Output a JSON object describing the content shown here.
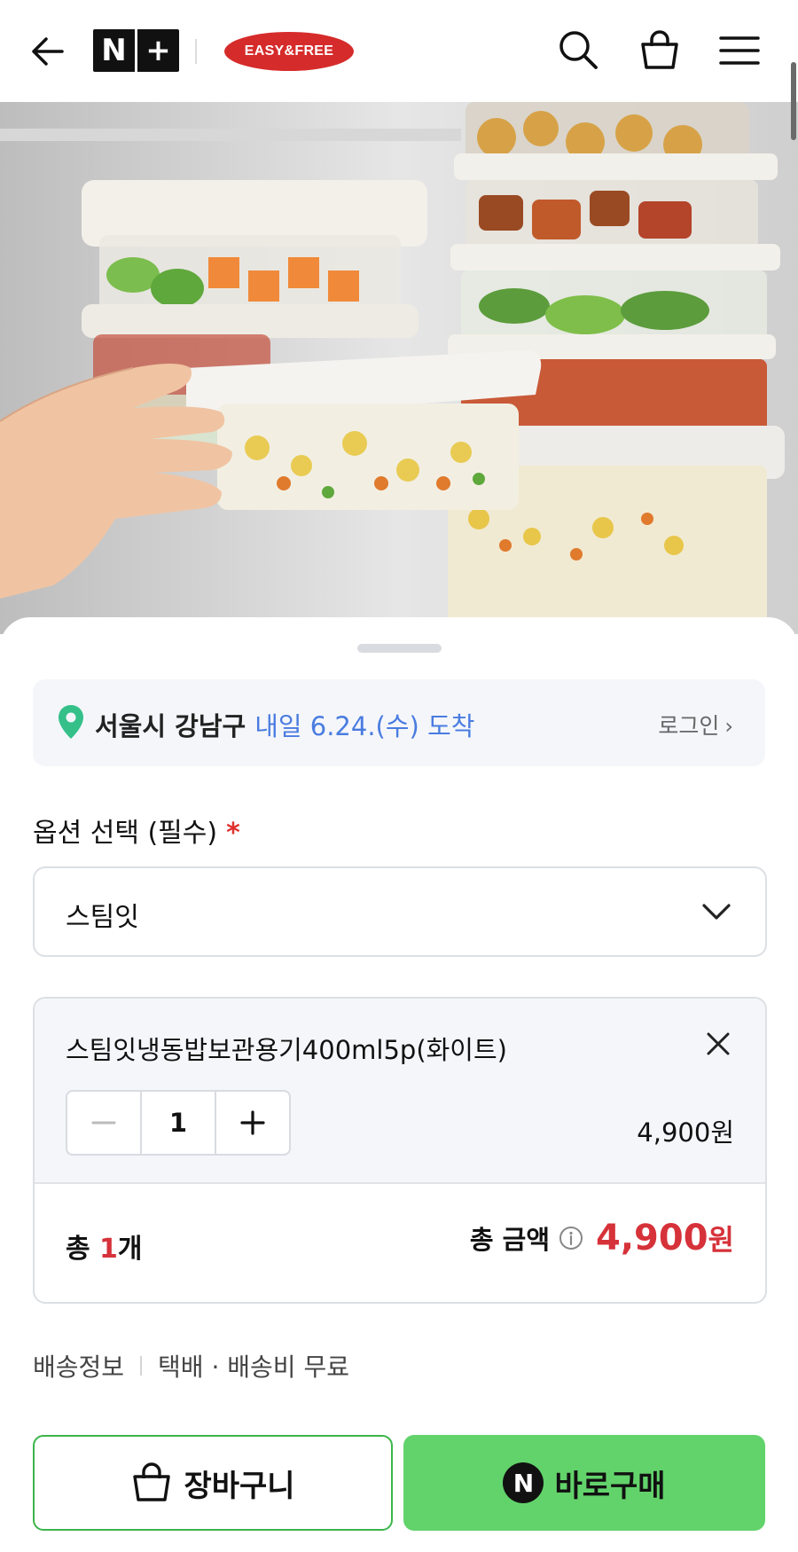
{
  "header": {
    "logo_n": "N",
    "logo_plus": "+",
    "brand": "EASY&FREE",
    "icons": [
      "back-arrow-icon",
      "search-icon",
      "shopping-bag-icon",
      "menu-icon"
    ]
  },
  "product_image": {
    "description_icon": "food-storage-containers-image"
  },
  "delivery": {
    "address": "서울시 강남구",
    "eta": "내일 6.24.(수) 도착",
    "login": "로그인",
    "login_chevron": "›",
    "pin_color": "#35c08a"
  },
  "options": {
    "label": "옵션 선택 (필수)",
    "required_mark": "*",
    "selected": "스팀잇"
  },
  "item": {
    "name": "스팀잇냉동밥보관용기400ml5p(화이트)",
    "quantity": "1",
    "price": "4,900원"
  },
  "totals": {
    "count_prefix": "총 ",
    "count_num": "1",
    "count_suffix": "개",
    "amount_label": "총 금액",
    "amount": "4,900",
    "currency": "원"
  },
  "shipping": {
    "label": "배송정보",
    "detail": "택배 · 배송비 무료"
  },
  "actions": {
    "cart": "장바구니",
    "buy": "바로구매",
    "buy_badge": "N"
  },
  "colors": {
    "accent_green": "#62d36b",
    "price_red": "#d6323a",
    "link_blue": "#4a7ce0"
  }
}
